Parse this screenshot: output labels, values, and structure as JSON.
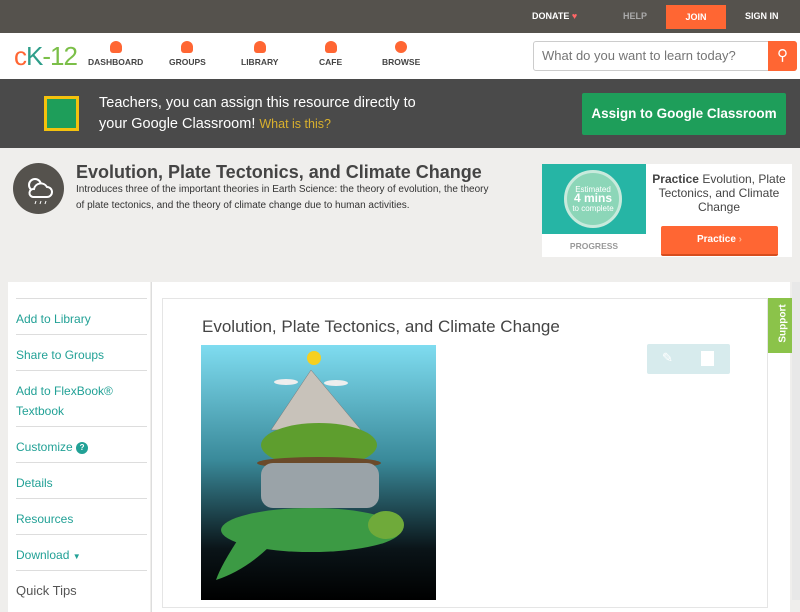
{
  "topbar": {
    "donate": "DONATE",
    "help": "HELP",
    "join": "JOIN",
    "signin": "SIGN IN"
  },
  "logo": {
    "c": "c",
    "k": "K",
    "rest": "-12"
  },
  "nav": [
    {
      "label": "DASHBOARD"
    },
    {
      "label": "GROUPS"
    },
    {
      "label": "LIBRARY"
    },
    {
      "label": "CAFE"
    },
    {
      "label": "BROWSE"
    }
  ],
  "search": {
    "placeholder": "What do you want to learn today?"
  },
  "banner": {
    "text": "Teachers, you can assign this resource directly to your Google Classroom!",
    "link": "What is this?",
    "button": "Assign to Google Classroom"
  },
  "concept": {
    "title": "Evolution, Plate Tectonics, and Climate Change",
    "description": "Introduces three of the important theories in Earth Science: the theory of evolution, the theory of plate tectonics, and the theory of climate change due to human activities."
  },
  "practice": {
    "estimated": "Estimated",
    "mins": "4 mins",
    "complete": "to complete",
    "progress": "PROGRESS",
    "title_bold": "Practice",
    "title_rest": " Evolution, Plate Tectonics, and Climate Change",
    "button": "Practice"
  },
  "sidebar": {
    "items": [
      "Add to Library",
      "Share to Groups",
      "Add to FlexBook® Textbook",
      "Customize",
      "Details",
      "Resources",
      "Download"
    ],
    "quick_tips": "Quick Tips"
  },
  "content": {
    "title": "Evolution, Plate Tectonics, and Climate Change"
  },
  "support": "Support",
  "colors": {
    "accent": "#ff6633",
    "teal": "#22a196",
    "green": "#1e9e5a"
  }
}
